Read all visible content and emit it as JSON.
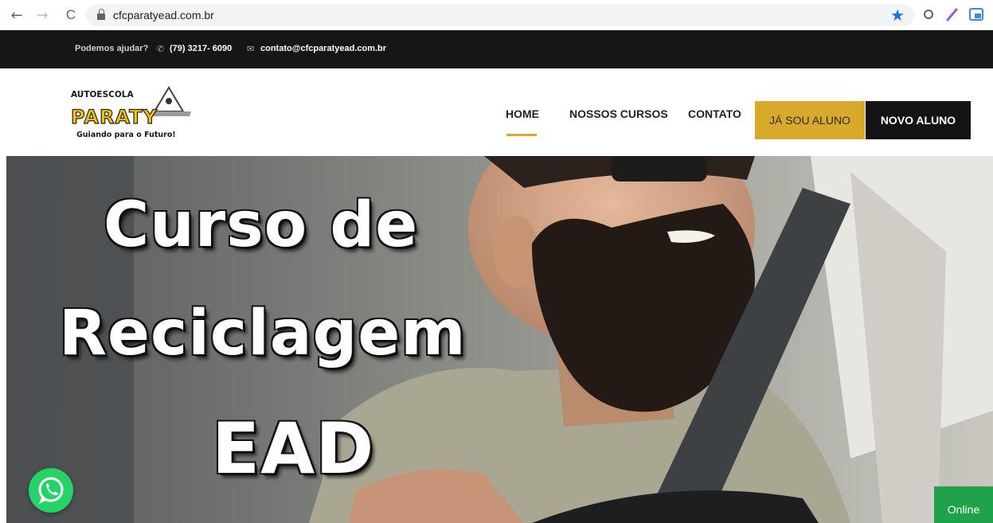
{
  "browser": {
    "url": "cfcparatyead.com.br",
    "back_icon": "←",
    "forward_icon": "→",
    "reload_icon": "C",
    "star_icon": "★"
  },
  "topbar": {
    "help_label": "Podemos ajudar?",
    "phone_icon": "✆",
    "phone": "(79) 3217- 6090",
    "mail_icon": "✉",
    "email": "contato@cfcparatyead.com.br"
  },
  "logo": {
    "top_text": "AUTOESCOLA",
    "brand": "PARATY",
    "tagline": "Guiando para o Futuro!"
  },
  "nav": {
    "home": "HOME",
    "courses": "NOSSOS CURSOS",
    "contact": "CONTATO",
    "student_button": "JÁ SOU ALUNO",
    "new_student_button": "NOVO ALUNO"
  },
  "hero": {
    "line1": "Curso de",
    "line2": "Reciclagem",
    "line3": "EAD"
  },
  "chat": {
    "online_label": "Online"
  },
  "colors": {
    "accent": "#d8a92b",
    "dark": "#141414",
    "whatsapp": "#25d366",
    "online": "#1fa34a"
  }
}
